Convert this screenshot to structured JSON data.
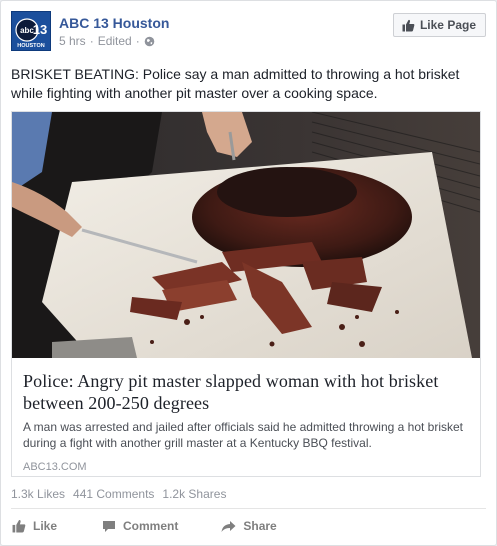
{
  "post": {
    "page_name": "ABC 13 Houston",
    "logo": {
      "top": "abc",
      "number": "13",
      "bottom": "HOUSTON"
    },
    "time": "5 hrs",
    "separator": "·",
    "edited": "Edited",
    "privacy_icon": "globe-icon",
    "like_page_label": "Like Page",
    "message": "BRISKET BEATING: Police say a man admitted to throwing a hot brisket while fighting with another pit master over a cooking space."
  },
  "link": {
    "title": "Police: Angry pit master slapped woman with hot brisket between 200-250 degrees",
    "description": "A man was arrested and jailed after officials said he admitted throwing a hot brisket during a fight with another grill master at a Kentucky BBQ festival.",
    "source": "ABC13.COM"
  },
  "stats": {
    "likes": "1.3k Likes",
    "comments": "441 Comments",
    "shares": "1.2k Shares"
  },
  "actions": {
    "like": "Like",
    "comment": "Comment",
    "share": "Share"
  },
  "colors": {
    "link_blue": "#365899",
    "muted": "#90949c",
    "action_gray": "#7f7f7f"
  }
}
